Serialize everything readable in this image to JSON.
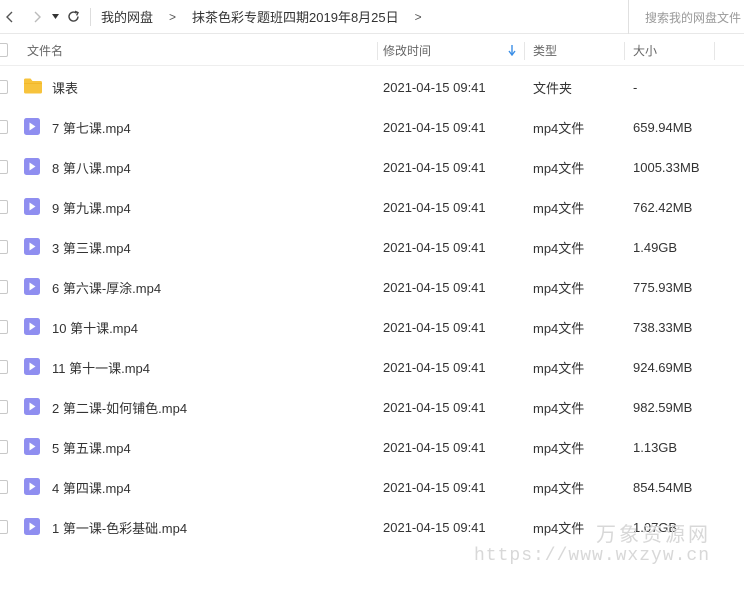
{
  "nav": {
    "crumbs": [
      "我的网盘",
      "抹茶色彩专题班四期2019年8月25日"
    ],
    "crumb_separator": ">",
    "search_placeholder": "搜索我的网盘文件"
  },
  "columns": {
    "name": "文件名",
    "modified": "修改时间",
    "type": "类型",
    "size": "大小"
  },
  "colors": {
    "accent": "#3a8ee6",
    "folder": "#f7c33c",
    "video": "#8f8ef0"
  },
  "files": [
    {
      "name": "课表",
      "modified": "2021-04-15 09:41",
      "type": "文件夹",
      "size": "-",
      "icon": "folder-icon"
    },
    {
      "name": "7 第七课.mp4",
      "modified": "2021-04-15 09:41",
      "type": "mp4文件",
      "size": "659.94MB",
      "icon": "video-file-icon"
    },
    {
      "name": "8 第八课.mp4",
      "modified": "2021-04-15 09:41",
      "type": "mp4文件",
      "size": "1005.33MB",
      "icon": "video-file-icon"
    },
    {
      "name": "9 第九课.mp4",
      "modified": "2021-04-15 09:41",
      "type": "mp4文件",
      "size": "762.42MB",
      "icon": "video-file-icon"
    },
    {
      "name": "3 第三课.mp4",
      "modified": "2021-04-15 09:41",
      "type": "mp4文件",
      "size": "1.49GB",
      "icon": "video-file-icon"
    },
    {
      "name": "6 第六课-厚涂.mp4",
      "modified": "2021-04-15 09:41",
      "type": "mp4文件",
      "size": "775.93MB",
      "icon": "video-file-icon"
    },
    {
      "name": "10 第十课.mp4",
      "modified": "2021-04-15 09:41",
      "type": "mp4文件",
      "size": "738.33MB",
      "icon": "video-file-icon"
    },
    {
      "name": "11 第十一课.mp4",
      "modified": "2021-04-15 09:41",
      "type": "mp4文件",
      "size": "924.69MB",
      "icon": "video-file-icon"
    },
    {
      "name": "2 第二课-如何铺色.mp4",
      "modified": "2021-04-15 09:41",
      "type": "mp4文件",
      "size": "982.59MB",
      "icon": "video-file-icon"
    },
    {
      "name": "5 第五课.mp4",
      "modified": "2021-04-15 09:41",
      "type": "mp4文件",
      "size": "1.13GB",
      "icon": "video-file-icon"
    },
    {
      "name": "4 第四课.mp4",
      "modified": "2021-04-15 09:41",
      "type": "mp4文件",
      "size": "854.54MB",
      "icon": "video-file-icon"
    },
    {
      "name": "1 第一课-色彩基础.mp4",
      "modified": "2021-04-15 09:41",
      "type": "mp4文件",
      "size": "1.07GB",
      "icon": "video-file-icon"
    }
  ],
  "watermark": {
    "cn": "万象资源网",
    "url": "https://www.wxzyw.cn"
  }
}
